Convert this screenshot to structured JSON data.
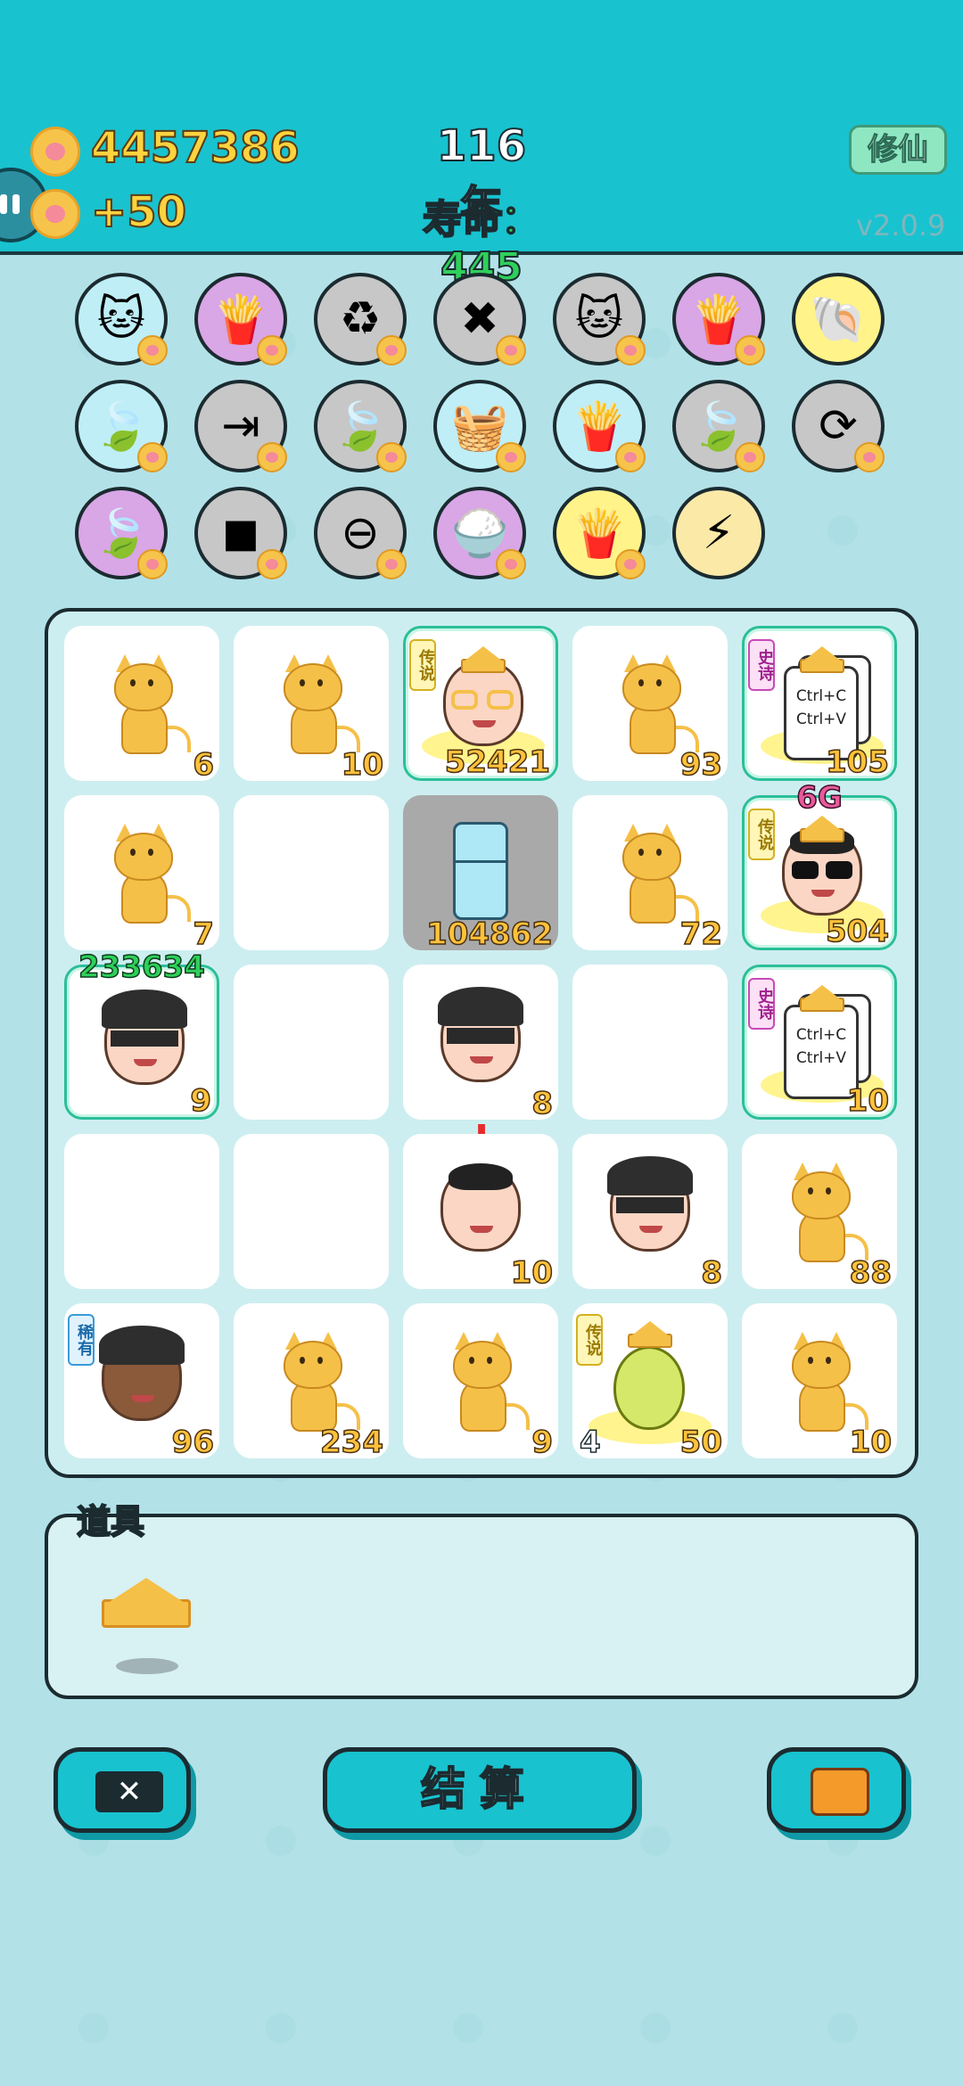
{
  "header": {
    "coins": "4457386",
    "income": "+50",
    "year": "116年",
    "lifespan": "寿命：445",
    "cultivate_button": "修仙",
    "version": "v2.0.9"
  },
  "items": [
    {
      "icon": "cat-icon",
      "bg": "#bfeef7"
    },
    {
      "icon": "fries-icon",
      "bg": "#d9a6e6"
    },
    {
      "icon": "recycle-icon",
      "bg": "#c7c7c7"
    },
    {
      "icon": "delete-tag-icon",
      "bg": "#c7c7c7"
    },
    {
      "icon": "cat-pair-icon",
      "bg": "#c7c7c7"
    },
    {
      "icon": "fries-icon",
      "bg": "#d9a6e6"
    },
    {
      "icon": "shell-icon",
      "bg": "#fff38a"
    },
    {
      "icon": "leaf-icon",
      "bg": "#bfeef7"
    },
    {
      "icon": "skip-icon",
      "bg": "#c7c7c7"
    },
    {
      "icon": "leaf-icon",
      "bg": "#c7c7c7"
    },
    {
      "icon": "fruit-basket-icon",
      "bg": "#bfeef7"
    },
    {
      "icon": "fries-icon",
      "bg": "#bfeef7"
    },
    {
      "icon": "leaf-icon",
      "bg": "#c7c7c7"
    },
    {
      "icon": "refresh-icon",
      "bg": "#c7c7c7"
    },
    {
      "icon": "leaf-icon",
      "bg": "#d9a6e6"
    },
    {
      "icon": "cubes-icon",
      "bg": "#c7c7c7"
    },
    {
      "icon": "minus-icon",
      "bg": "#c7c7c7"
    },
    {
      "icon": "rice-bowl-icon",
      "bg": "#d9a6e6"
    },
    {
      "icon": "fries-icon",
      "bg": "#fff38a"
    },
    {
      "icon": "lightning-icon",
      "bg": "#fbe9a8"
    }
  ],
  "board": {
    "r0c0": {
      "count": "6"
    },
    "r0c1": {
      "count": "10"
    },
    "r0c2": {
      "count": "52421",
      "tag": "传说"
    },
    "r0c3": {
      "count": "93"
    },
    "r0c4": {
      "count": "105",
      "tag": "史诗",
      "line1": "Ctrl+C",
      "line2": "Ctrl+V"
    },
    "r1c0": {
      "count": "7"
    },
    "r1c2": {
      "count": "104862"
    },
    "r1c3": {
      "count": "72"
    },
    "r1c4": {
      "count": "504",
      "tag": "传说",
      "top": "6G"
    },
    "r2c0": {
      "count": "9",
      "top": "233634"
    },
    "r2c2": {
      "count": "8",
      "alert": "!"
    },
    "r2c4": {
      "count": "10",
      "tag": "史诗",
      "line1": "Ctrl+C",
      "line2": "Ctrl+V"
    },
    "r3c2": {
      "count": "10"
    },
    "r3c3": {
      "count": "8"
    },
    "r3c4": {
      "count": "88"
    },
    "r4c0": {
      "count": "96",
      "tag": "稀有"
    },
    "r4c1": {
      "count": "234"
    },
    "r4c2": {
      "count": "9"
    },
    "r4c3": {
      "count": "50",
      "left": "4",
      "tag": "传说"
    },
    "r4c4": {
      "count": "10"
    }
  },
  "props": {
    "label": "道具",
    "item": "crown-icon"
  },
  "buttons": {
    "remove": "✕",
    "settle": "结算",
    "bag": "briefcase-icon"
  }
}
